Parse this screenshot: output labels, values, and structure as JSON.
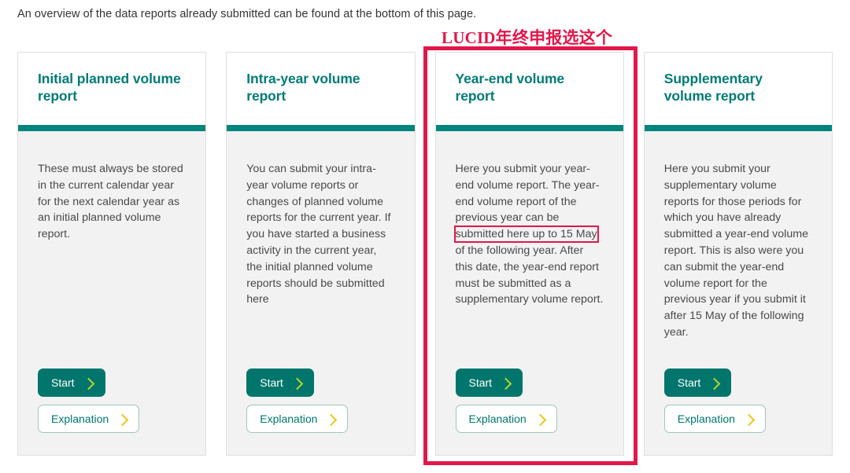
{
  "intro": {
    "text": "An overview of the data reports already submitted can be found at the bottom of this page."
  },
  "annotation": {
    "label": "LUCID年终申报选这个",
    "color": "#e2174a",
    "highlighted_card_index": 2,
    "inline_highlight_text": "submitted here up to 15 May"
  },
  "theme": {
    "title_color": "#007b75",
    "rule_color": "#00857d",
    "card_background": "#f2f2f2",
    "header_background": "#ffffff",
    "body_text_color": "#4a4a4a",
    "start_button_background": "#00756c",
    "start_button_text": "#ffffff",
    "start_chevron_color": "#b8d430",
    "explanation_chevron_color": "#f0c419",
    "explanation_border": "#9ec5c1"
  },
  "cards": [
    {
      "title": "Initial planned volume report",
      "body": "These must always be stored in the current calendar year for the next calendar year as an initial planned volume report.",
      "start_label": "Start",
      "explanation_label": "Explanation"
    },
    {
      "title": "Intra-year volume report",
      "body": "You can submit your intra-year volume reports or changes of planned volume reports for the current year. If you have started a business activity in the current year, the initial planned volume reports should be submitted here",
      "start_label": "Start",
      "explanation_label": "Explanation"
    },
    {
      "title": "Year-end volume report",
      "body_part1": "Here you submit your year-end volume report. The year-end volume report of the previous year can be ",
      "body_highlight": "submitted here up to 15 May",
      "body_part2": " of the following year. After this date, the year-end report must be submitted as a supplementary volume report.",
      "start_label": "Start",
      "explanation_label": "Explanation"
    },
    {
      "title": "Supplementary volume report",
      "body": "Here you submit your supplementary volume reports for those periods for which you have already submitted a year-end volume report. This is also were you can submit the year-end volume report for the previous year if you submit it after 15 May of the following year.",
      "start_label": "Start",
      "explanation_label": "Explanation"
    }
  ]
}
